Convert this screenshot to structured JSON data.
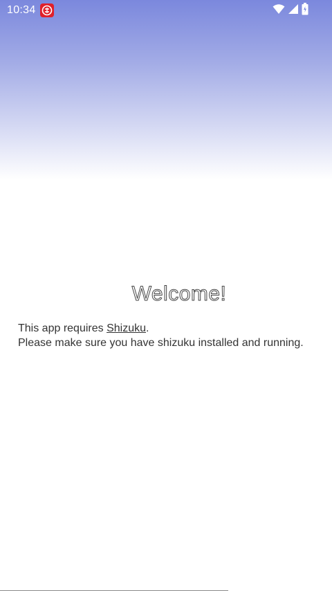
{
  "status_bar": {
    "time": "10:34",
    "notification_icon": "app-notification-icon",
    "wifi_icon": "wifi-icon",
    "signal_icon": "cell-signal-icon",
    "battery_icon": "battery-icon"
  },
  "welcome": {
    "title": "Welcome!",
    "line1_prefix": "This app requires ",
    "link_label": "Shizuku",
    "line1_suffix": ".",
    "line2": "Please make sure you have shizuku installed and running."
  },
  "colors": {
    "gradient_top": "#7b88dd",
    "notification_red": "#e0202a",
    "text": "#333333"
  }
}
